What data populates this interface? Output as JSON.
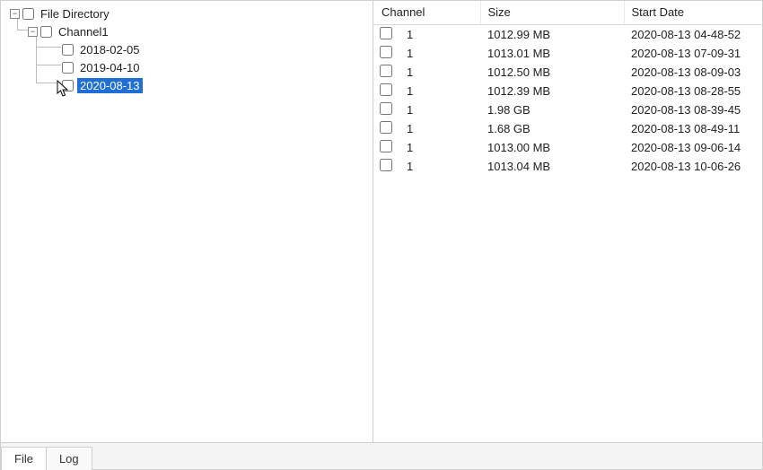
{
  "tree": {
    "root_label": "File Directory",
    "channel_label": "Channel1",
    "dates": [
      {
        "label": "2018-02-05",
        "selected": false
      },
      {
        "label": "2019-04-10",
        "selected": false
      },
      {
        "label": "2020-08-13",
        "selected": true
      }
    ]
  },
  "table": {
    "headers": {
      "channel": "Channel",
      "size": "Size",
      "start_date": "Start Date"
    },
    "rows": [
      {
        "channel": "1",
        "size": "1012.99 MB",
        "start": "2020-08-13 04-48-52"
      },
      {
        "channel": "1",
        "size": "1013.01 MB",
        "start": "2020-08-13 07-09-31"
      },
      {
        "channel": "1",
        "size": "1012.50 MB",
        "start": "2020-08-13 08-09-03"
      },
      {
        "channel": "1",
        "size": "1012.39 MB",
        "start": "2020-08-13 08-28-55"
      },
      {
        "channel": "1",
        "size": "1.98 GB",
        "start": "2020-08-13 08-39-45"
      },
      {
        "channel": "1",
        "size": "1.68 GB",
        "start": "2020-08-13 08-49-11"
      },
      {
        "channel": "1",
        "size": "1013.00 MB",
        "start": "2020-08-13 09-06-14"
      },
      {
        "channel": "1",
        "size": "1013.04 MB",
        "start": "2020-08-13 10-06-26"
      }
    ]
  },
  "tabs": {
    "file": "File",
    "log": "Log",
    "active": "file"
  },
  "glyphs": {
    "minus": "−"
  }
}
